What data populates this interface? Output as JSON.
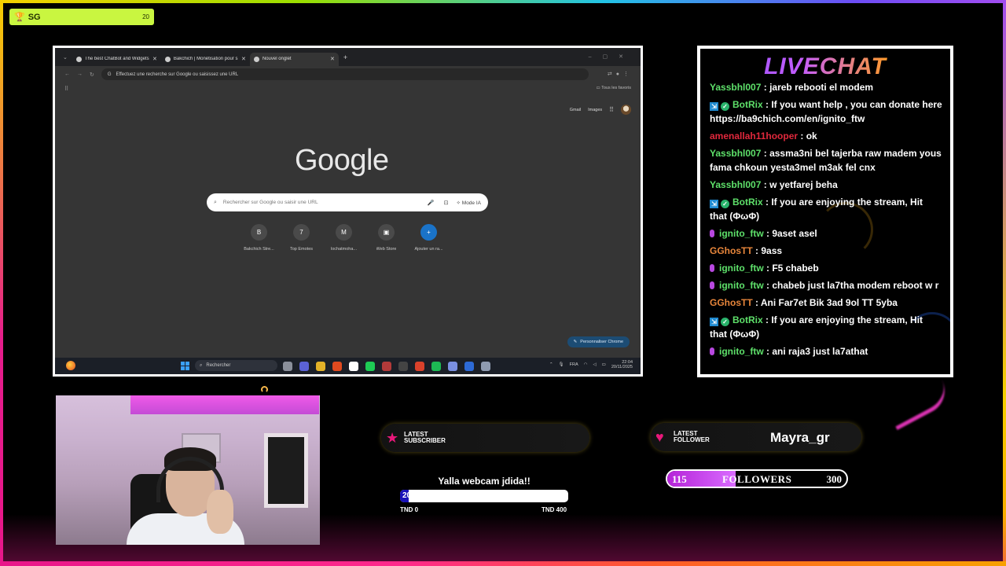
{
  "overlay": {
    "badge_label": "SG",
    "badge_count": "20"
  },
  "browser": {
    "tabs": [
      {
        "label": "The best ChatBot and Widgets",
        "active": false
      },
      {
        "label": "Bakchich | Monétisation pour s",
        "active": false
      },
      {
        "label": "Nouvel onglet",
        "active": true
      }
    ],
    "address_placeholder": "Effectuez une recherche sur Google ou saisissez une URL",
    "all_favorites": "Tous les favoris",
    "gmail": "Gmail",
    "images": "Images",
    "logo": "Google",
    "search_placeholder": "Rechercher sur Google ou saisir une URL",
    "mode_ia": "Mode IA",
    "shortcuts": [
      {
        "label": "Bakchich Stre...",
        "icon": "B"
      },
      {
        "label": "Top Emotes",
        "icon": "7"
      },
      {
        "label": "lochatmoha...",
        "icon": "M"
      },
      {
        "label": "Web Store",
        "icon": "▣"
      },
      {
        "label": "Ajouter un ra...",
        "icon": "+"
      }
    ],
    "customize_label": "Personnaliser Chrome"
  },
  "taskbar": {
    "search_label": "Rechercher",
    "lang": "FRA",
    "time": "22:04",
    "date": "20/11/2025",
    "app_colors": [
      "#8a8f9a",
      "#5b62d6",
      "#e2b128",
      "#e04a1f",
      "#ffffff",
      "#1ecb55",
      "#b23a3a",
      "#444444",
      "#d9412b",
      "#1db954",
      "#7a8fe0",
      "#2d6ad6",
      "#8f9bb0"
    ]
  },
  "chat": {
    "title": "LIVECHAT",
    "messages": [
      {
        "user": "Yassbhl007",
        "text": "jareb rebooti el modem",
        "color": "green",
        "badges": []
      },
      {
        "user": "BotRix",
        "text": "If you want help , you can donate here https://ba9chich.com/en/ignito_ftw",
        "color": "green",
        "badges": [
          "tag",
          "check"
        ],
        "wrap": true
      },
      {
        "user": "amenallah11hooper",
        "text": "ok",
        "color": "red",
        "badges": []
      },
      {
        "user": "Yassbhl007",
        "text": "assma3ni bel tajerba raw madem yous fama chkoun yesta3mel m3ak fel cnx",
        "color": "green",
        "badges": [],
        "wrap": true
      },
      {
        "user": "Yassbhl007",
        "text": "w yetfarej beha",
        "color": "green",
        "badges": []
      },
      {
        "user": "BotRix",
        "text": "If you are enjoying the stream, Hit that (ΦωΦ)",
        "color": "green",
        "badges": [
          "tag",
          "check"
        ],
        "wrap": true
      },
      {
        "user": "ignito_ftw",
        "text": "9aset asel",
        "color": "green",
        "badges": [
          "mic"
        ]
      },
      {
        "user": "GGhosTT",
        "text": "9ass",
        "color": "orange",
        "badges": []
      },
      {
        "user": "ignito_ftw",
        "text": "F5 chabeb",
        "color": "green",
        "badges": [
          "mic"
        ]
      },
      {
        "user": "ignito_ftw",
        "text": "chabeb just la7tha modem reboot w r",
        "color": "green",
        "badges": [
          "mic"
        ]
      },
      {
        "user": "GGhosTT",
        "text": "Ani Far7et Bik 3ad 9ol TT 5yba",
        "color": "orange",
        "badges": []
      },
      {
        "user": "BotRix",
        "text": "If you are enjoying the stream, Hit that (ΦωΦ)",
        "color": "green",
        "badges": [
          "tag",
          "check"
        ],
        "wrap": true
      },
      {
        "user": "ignito_ftw",
        "text": "ani raja3 just la7athat",
        "color": "green",
        "badges": [
          "mic"
        ]
      }
    ]
  },
  "latest_subscriber": {
    "label_line1": "LATEST",
    "label_line2": "SUBSCRIBER",
    "value": ""
  },
  "latest_follower": {
    "label_line1": "LATEST",
    "label_line2": "FOLLOWER",
    "value": "Mayra_gr"
  },
  "donation_goal": {
    "title": "Yalla webcam jdida!!",
    "current": "20",
    "progress": 0.05,
    "min_label": "TND 0",
    "max_label": "TND 400"
  },
  "followers_goal": {
    "min": "115",
    "label": "FOLLOWERS",
    "max": "300",
    "progress": 0.38
  },
  "colors": {
    "badge": "#c9f640",
    "accent_pink": "#e8187a",
    "user_green": "#5ee06a",
    "user_red": "#e0283c",
    "user_orange": "#e8863b",
    "goal_fill": "#1a12b8",
    "followers_fill": "#b524d8"
  }
}
